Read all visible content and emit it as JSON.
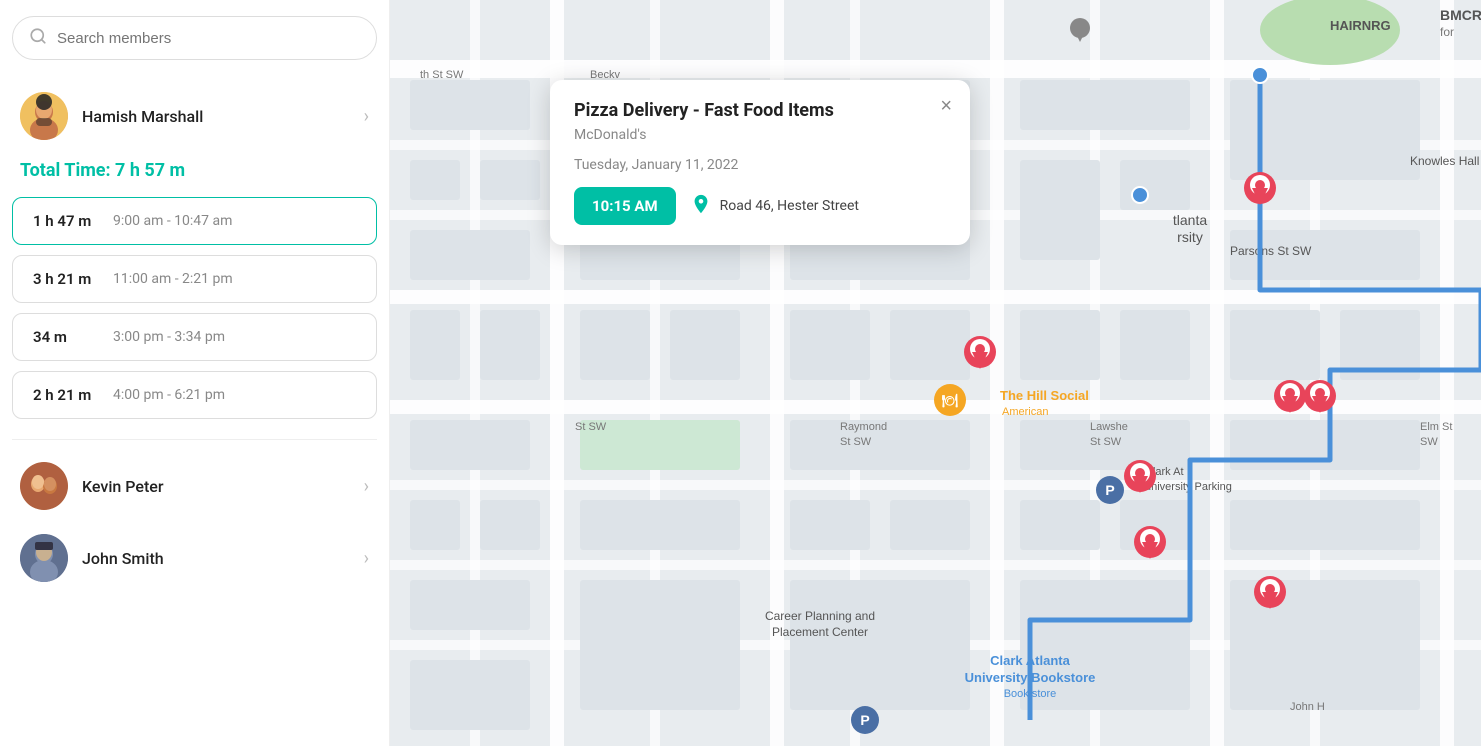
{
  "search": {
    "placeholder": "Search members"
  },
  "members": [
    {
      "id": "hamish-marshall",
      "name": "Hamish Marshall",
      "avatar_type": "hamish",
      "avatar_emoji": "🧑"
    },
    {
      "id": "kevin-peter",
      "name": "Kevin Peter",
      "avatar_type": "kevin",
      "avatar_emoji": "👫"
    },
    {
      "id": "john-smith",
      "name": "John Smith",
      "avatar_type": "john",
      "avatar_emoji": "🧔"
    }
  ],
  "total_time": {
    "label": "Total Time: 7 h 57 m"
  },
  "time_blocks": [
    {
      "duration": "1 h 47 m",
      "range": "9:00 am - 10:47 am",
      "active": true
    },
    {
      "duration": "3 h 21 m",
      "range": "11:00 am - 2:21 pm",
      "active": false
    },
    {
      "duration": "34 m",
      "range": "3:00 pm - 3:34 pm",
      "active": false
    },
    {
      "duration": "2 h 21 m",
      "range": "4:00 pm - 6:21 pm",
      "active": false
    }
  ],
  "popup": {
    "title": "Pizza Delivery - Fast Food Items",
    "subtitle": "McDonald's",
    "date": "Tuesday, January 11, 2022",
    "time": "10:15 AM",
    "location": "Road 46, Hester Street",
    "close_label": "×"
  }
}
